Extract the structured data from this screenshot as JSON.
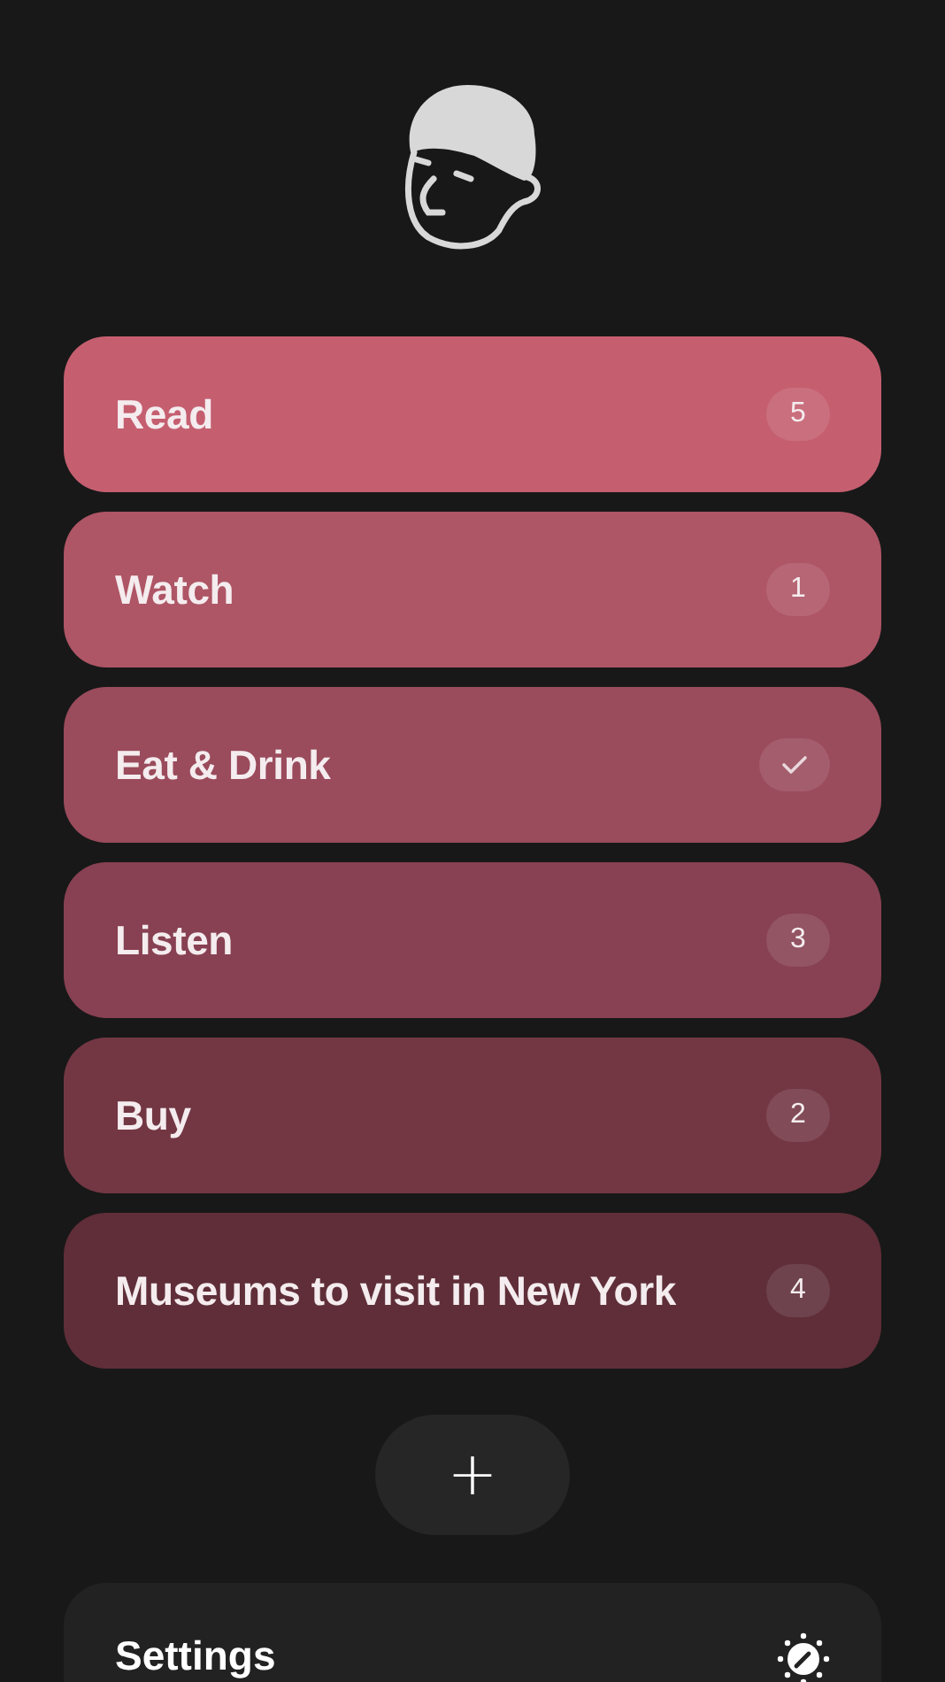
{
  "lists": [
    {
      "kind": "count",
      "name": "Read",
      "count": "5",
      "color": "#c55f70"
    },
    {
      "kind": "count",
      "name": "Watch",
      "count": "1",
      "color": "#ae5566"
    },
    {
      "kind": "done",
      "name": "Eat & Drink",
      "color": "#9a4b5c"
    },
    {
      "kind": "count",
      "name": "Listen",
      "count": "3",
      "color": "#874152"
    },
    {
      "kind": "count",
      "name": "Buy",
      "count": "2",
      "color": "#733744"
    },
    {
      "kind": "count",
      "name": "Museums to visit in New York",
      "count": "4",
      "color": "#5f2e39"
    }
  ],
  "add_button": {
    "label": "+"
  },
  "settings": {
    "label": "Settings"
  }
}
